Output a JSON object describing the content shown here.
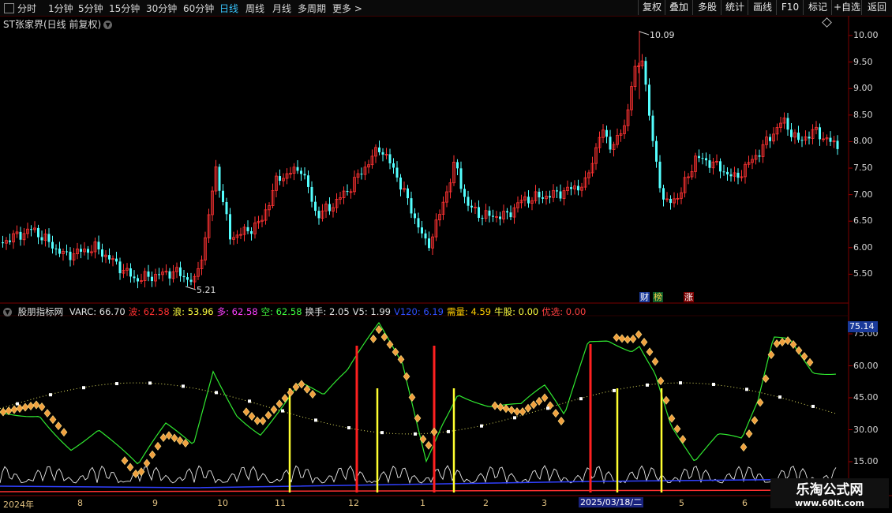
{
  "toolbar": {
    "menu_icon": "menu-icon",
    "timeframes": [
      "分时",
      "1分钟",
      "5分钟",
      "15分钟",
      "30分钟",
      "60分钟",
      "日线",
      "周线",
      "月线",
      "多周期",
      "更多 >"
    ],
    "active_timeframe": "日线",
    "buttons": [
      "复权",
      "叠加",
      "多股",
      "统计",
      "画线",
      "F10",
      "标记",
      "+自选",
      "返回"
    ]
  },
  "stock": {
    "title": "ST张家界(日线 前复权)"
  },
  "price_axis": [
    "10.00",
    "9.50",
    "9.00",
    "8.50",
    "8.00",
    "7.50",
    "7.00",
    "6.50",
    "6.00",
    "5.50"
  ],
  "annotations": {
    "high": "10.09",
    "low": "5.21"
  },
  "badges": {
    "cai": "财",
    "bang": "榜",
    "zhang": "涨"
  },
  "indicator": {
    "name": "股朋指标网",
    "items": [
      {
        "label": "VARC: 66.70",
        "color": "#e0e0e0"
      },
      {
        "label": "波: 62.58",
        "color": "#ff3030"
      },
      {
        "label": "浪: 53.96",
        "color": "#ffff40"
      },
      {
        "label": "多: 62.58",
        "color": "#ff40ff"
      },
      {
        "label": "空: 62.58",
        "color": "#40ff40"
      },
      {
        "label": "换手: 2.05",
        "color": "#e0e0e0"
      },
      {
        "label": "V5: 1.99",
        "color": "#e0e0e0"
      },
      {
        "label": "V120: 6.19",
        "color": "#3050ff"
      },
      {
        "label": "需量: 4.59",
        "color": "#ffcc00"
      },
      {
        "label": "牛股: 0.00",
        "color": "#ffff40"
      },
      {
        "label": "优选: 0.00",
        "color": "#ff4040"
      }
    ],
    "axis": [
      "75.00",
      "60.00",
      "45.00",
      "30.00",
      "15.00"
    ],
    "highlight": "75.14"
  },
  "dates": [
    "2024年",
    "8",
    "9",
    "10",
    "11",
    "12",
    "1",
    "2",
    "3",
    "4",
    "5",
    "6"
  ],
  "current_date": "2025/03/18/二",
  "watermark": {
    "name": "乐淘公式网",
    "url": "www.60lt.com"
  }
}
